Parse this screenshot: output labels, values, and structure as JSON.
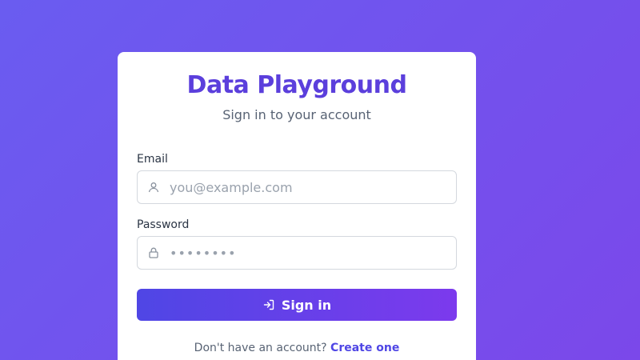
{
  "app": {
    "title": "Data Playground",
    "subtitle": "Sign in to your account"
  },
  "form": {
    "email_label": "Email",
    "email_placeholder": "you@example.com",
    "email_value": "",
    "email_icon": "user-icon",
    "password_label": "Password",
    "password_placeholder": "••••••••",
    "password_value": "",
    "password_icon": "lock-icon",
    "submit_label": "Sign in",
    "submit_icon": "sign-in-icon"
  },
  "footer": {
    "prompt": "Don't have an account?",
    "link_label": "Create one"
  },
  "colors": {
    "brand": "#5b3fdc",
    "button_start": "#4f46e5",
    "button_end": "#7c3aed",
    "background_start": "#6a5cf0",
    "background_end": "#7b48ea"
  }
}
